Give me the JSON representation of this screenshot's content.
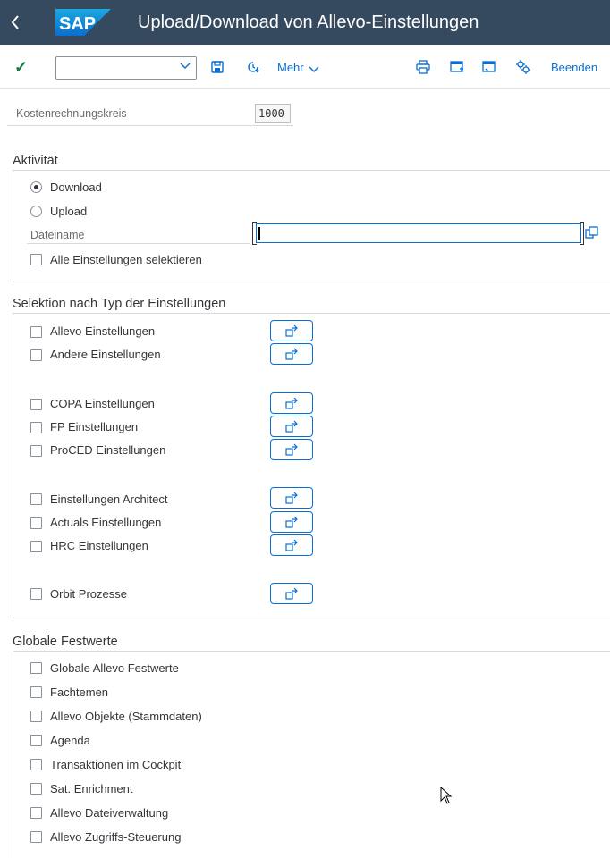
{
  "shell": {
    "title": "Upload/Download von Allevo-Einstellungen",
    "logo_text": "SAP",
    "back_icon": "back-chevron-icon"
  },
  "toolbar": {
    "command_field_value": "",
    "more_label": "Mehr",
    "exit_label": "Beenden"
  },
  "header_fields": {
    "controlling_area_label": "Kostenrechnungskreis",
    "controlling_area_value": "1000"
  },
  "activity": {
    "title": "Aktivität",
    "options": [
      "Download",
      "Upload"
    ],
    "selected": "Download",
    "filename_label": "Dateiname",
    "filename_value": "",
    "select_all_label": "Alle Einstellungen selektieren"
  },
  "selection": {
    "title": "Selektion nach Typ der Einstellungen",
    "items": [
      {
        "label": "Allevo Einstellungen",
        "checked": false
      },
      {
        "label": "Andere Einstellungen",
        "checked": false
      },
      {
        "label": "COPA Einstellungen",
        "checked": false
      },
      {
        "label": "FP Einstellungen",
        "checked": false
      },
      {
        "label": "ProCED Einstellungen",
        "checked": false
      },
      {
        "label": "Einstellungen Architect",
        "checked": false
      },
      {
        "label": "Actuals Einstellungen",
        "checked": false
      },
      {
        "label": "HRC Einstellungen",
        "checked": false
      },
      {
        "label": "Orbit Prozesse",
        "checked": false
      }
    ]
  },
  "global": {
    "title": "Globale Festwerte",
    "items": [
      {
        "label": "Globale Allevo Festwerte",
        "checked": false
      },
      {
        "label": "Fachtemen",
        "checked": false
      },
      {
        "label": "Allevo Objekte (Stammdaten)",
        "checked": false
      },
      {
        "label": "Agenda",
        "checked": false
      },
      {
        "label": "Transaktionen im Cockpit",
        "checked": false
      },
      {
        "label": "Sat. Enrichment",
        "checked": false
      },
      {
        "label": "Allevo Dateiverwaltung",
        "checked": false
      },
      {
        "label": "Allevo Zugriffs-Steuerung",
        "checked": false
      }
    ]
  },
  "colors": {
    "shell_bg": "#354a5f",
    "accent": "#0a6ed1",
    "confirm": "#107e3e"
  }
}
